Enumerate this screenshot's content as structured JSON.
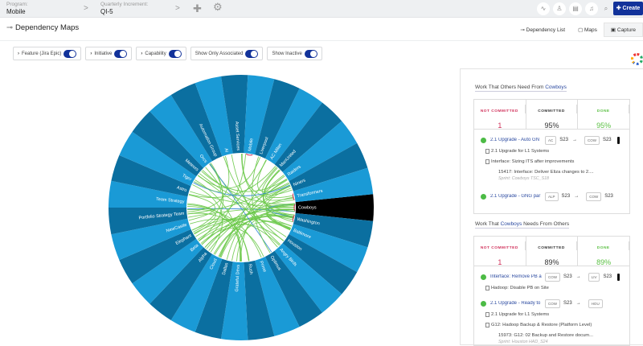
{
  "topbar": {
    "program_label": "Program:",
    "program_value": "Mobile",
    "qi_label": "Quarterly Increment:",
    "qi_value": "QI-5",
    "create_label": "Create"
  },
  "header": {
    "title": "Dependency Maps",
    "dependency_list": "Dependency List",
    "maps": "Maps",
    "capture": "Capture"
  },
  "toggles": [
    {
      "label": "Feature (Jira Epic)",
      "on": true,
      "expandable": true
    },
    {
      "label": "Initiative",
      "on": true,
      "expandable": true
    },
    {
      "label": "Capability",
      "on": true,
      "expandable": true
    },
    {
      "label": "Show Only Associated",
      "on": true,
      "expandable": false
    },
    {
      "label": "Show Inactive",
      "on": true,
      "expandable": false
    }
  ],
  "wheel": {
    "selected": "Cowboys",
    "colors": {
      "light": "#1a9ad6",
      "dark": "#0b6fa0",
      "selected": "#000000",
      "link": "#6cc94a",
      "link_alt": "#2f86d6",
      "self_link": "#d62a5a"
    },
    "teams": [
      "Cowboys",
      "Washington",
      "Baltimore",
      "Houston",
      "Angry Birds",
      "Optimus",
      "Prime",
      "Rush",
      "Grateful Devs",
      "Dallas",
      "Cloud",
      "Alpha",
      "Beta",
      "Elephant",
      "NewCastle",
      "Portfolio Strategy Team",
      "Team Strategy",
      "Astro",
      "Tiger",
      "Meteors",
      "Orcs",
      "Automation Group",
      "AI",
      "Asset Services",
      "Mobile",
      "Liverpool",
      "AC Milan",
      "ManUnited",
      "Raiders",
      "Niners",
      "Transformers"
    ]
  },
  "panel": {
    "provides": {
      "title_prefix": "Work That Others Need From",
      "team": "Cowboys",
      "title_suffix": "",
      "stats": [
        {
          "label": "NOT COMMITTED",
          "value": "1",
          "color": "#d0305a"
        },
        {
          "label": "COMMITTED",
          "value": "95%",
          "color": "#333333"
        },
        {
          "label": "DONE",
          "value": "95%",
          "color": "#5cc045"
        }
      ],
      "items": [
        {
          "title": "2.1 Upgrade - Auto GN",
          "from": "AC",
          "from_sprint": "S23",
          "to": "COW",
          "to_sprint": "S23"
        },
        {
          "sub": "2.1 Upgrade for L1 Systems"
        },
        {
          "sub": "Interface: Sizing ITS after improvements"
        },
        {
          "story": "15417: Interface: Deliver Eliza changes to 2....",
          "sprint": "Sprint: Cowboys TSC_S18"
        },
        {
          "title": "2.1 Upgrade - GNG par",
          "from": "ALP",
          "from_sprint": "S23",
          "to": "COW",
          "to_sprint": "S23"
        }
      ]
    },
    "needs": {
      "title_prefix": "Work That",
      "team": "Cowboys",
      "title_suffix": "Needs From Others",
      "stats": [
        {
          "label": "NOT COMMITTED",
          "value": "1",
          "color": "#d0305a"
        },
        {
          "label": "COMMITTED",
          "value": "89%",
          "color": "#333333"
        },
        {
          "label": "DONE",
          "value": "89%",
          "color": "#5cc045"
        }
      ],
      "items": [
        {
          "title": "Interface: Remove PB a",
          "from": "COW",
          "from_sprint": "S23",
          "to": "LIV",
          "to_sprint": "S23"
        },
        {
          "sub": "Hadoop: Disable PB on Site"
        },
        {
          "title": "2.1 Upgrade - Ready to",
          "from": "COW",
          "from_sprint": "S23",
          "to": "HOU",
          "to_sprint": ""
        },
        {
          "sub": "2.1 Upgrade for L1 Systems"
        },
        {
          "sub": "G12: Hadoop Backup & Restore (Platform Level)"
        },
        {
          "story": "15973: G12: 02 Backup and Restore docum...",
          "sprint": "Sprint: Houston HAD_S24"
        }
      ]
    }
  }
}
